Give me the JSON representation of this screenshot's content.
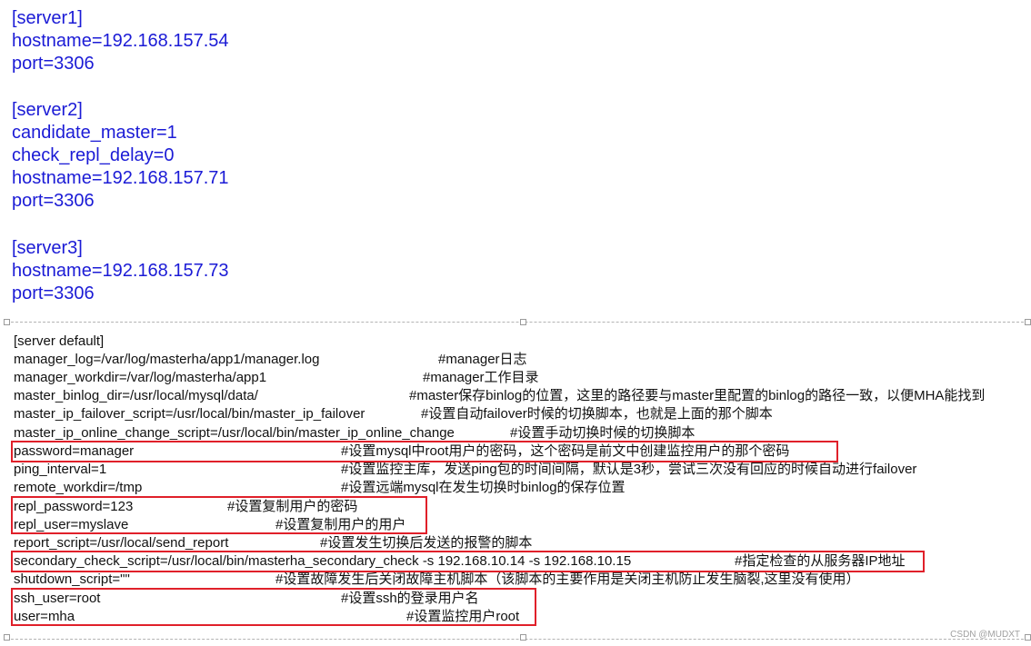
{
  "servers_block": [
    "[server1]",
    "hostname=192.168.157.54",
    "port=3306",
    "",
    "[server2]",
    "candidate_master=1",
    "check_repl_delay=0",
    "hostname=192.168.157.71",
    "port=3306",
    "",
    "[server3]",
    "hostname=192.168.157.73",
    "port=3306"
  ],
  "default_section": {
    "header": "[server default]",
    "lines": [
      {
        "text": "manager_log=/var/log/masterha/app1/manager.log",
        "comment": "#manager日志"
      },
      {
        "text": "manager_workdir=/var/log/masterha/app1",
        "comment": "#manager工作目录"
      },
      {
        "text": "master_binlog_dir=/usr/local/mysql/data/",
        "comment": "#master保存binlog的位置，这里的路径要与master里配置的binlog的路径一致，以便MHA能找到"
      },
      {
        "text": "master_ip_failover_script=/usr/local/bin/master_ip_failover",
        "comment": "#设置自动failover时候的切换脚本，也就是上面的那个脚本"
      },
      {
        "text": "master_ip_online_change_script=/usr/local/bin/master_ip_online_change",
        "comment": "#设置手动切换时候的切换脚本"
      },
      {
        "text": "password=manager",
        "comment": "#设置mysql中root用户的密码，这个密码是前文中创建监控用户的那个密码"
      },
      {
        "text": "ping_interval=1",
        "comment": "#设置监控主库，发送ping包的时间间隔，默认是3秒，尝试三次没有回应的时候自动进行failover"
      },
      {
        "text": "remote_workdir=/tmp",
        "comment": "#设置远端mysql在发生切换时binlog的保存位置"
      },
      {
        "text": "repl_password=123",
        "comment": "#设置复制用户的密码"
      },
      {
        "text": "repl_user=myslave",
        "comment": "#设置复制用户的用户"
      },
      {
        "text": "report_script=/usr/local/send_report",
        "comment": "#设置发生切换后发送的报警的脚本"
      },
      {
        "text": "secondary_check_script=/usr/local/bin/masterha_secondary_check -s 192.168.10.14 -s 192.168.10.15",
        "comment": "#指定检查的从服务器IP地址"
      },
      {
        "text": "shutdown_script=\"\"",
        "comment": "#设置故障发生后关闭故障主机脚本（该脚本的主要作用是关闭主机防止发生脑裂,这里没有使用）"
      },
      {
        "text": "ssh_user=root",
        "comment": "#设置ssh的登录用户名"
      },
      {
        "text": "user=mha",
        "comment": "#设置监控用户root"
      }
    ]
  },
  "highlight_color": "#e0202a",
  "text_color_blue": "#1b1bd6",
  "watermark": "CSDN @MUDXT"
}
